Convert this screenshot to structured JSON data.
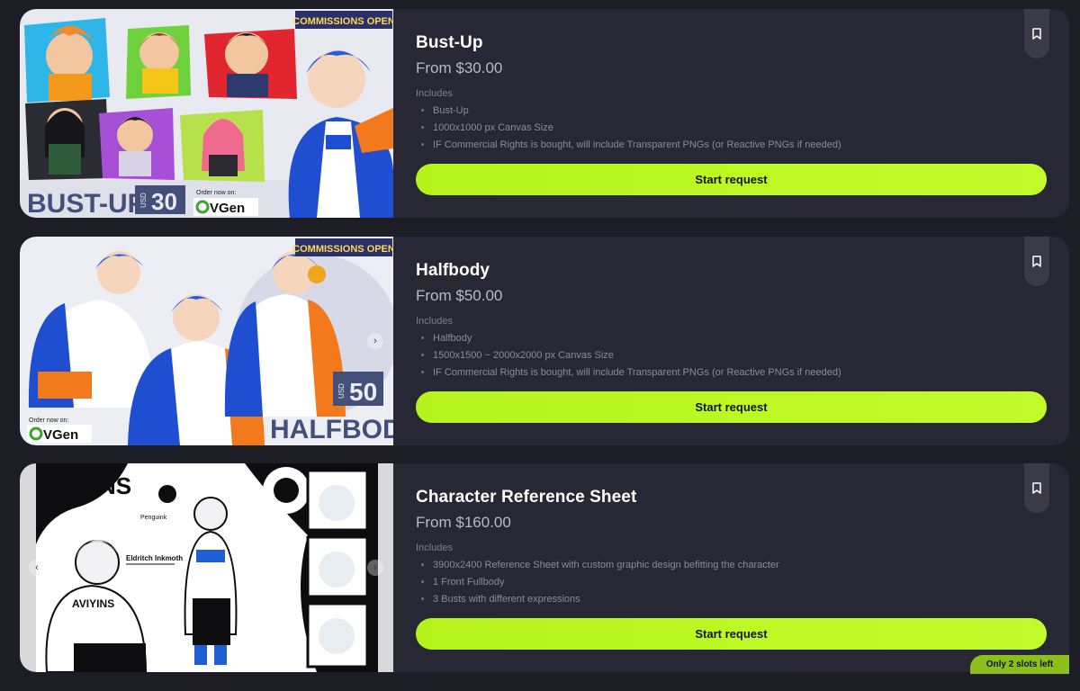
{
  "listings": [
    {
      "title": "Bust-Up",
      "price": "From $30.00",
      "includes_label": "Includes",
      "items": [
        "Bust-Up",
        "1000x1000 px Canvas Size",
        "IF Commercial Rights is bought, will include Transparent PNGs (or Reactive PNGs if needed)"
      ],
      "cta": "Start request",
      "image": {
        "banner": "COMMISSIONS OPEN",
        "headline": "BUST-UP",
        "usd_label": "USD",
        "price_tag": "30",
        "order_text": "Order now on:",
        "brand": "VGen"
      }
    },
    {
      "title": "Halfbody",
      "price": "From $50.00",
      "includes_label": "Includes",
      "items": [
        "Halfbody",
        "1500x1500 ~ 2000x2000 px Canvas Size",
        "IF Commercial Rights is bought, will include Transparent PNGs (or Reactive PNGs if needed)"
      ],
      "cta": "Start request",
      "image": {
        "banner": "COMMISSIONS OPEN",
        "headline": "HALFBODY",
        "usd_label": "USD",
        "price_tag": "50",
        "order_text": "Order now on:",
        "brand": "VGen"
      }
    },
    {
      "title": "Character Reference Sheet",
      "price": "From $160.00",
      "includes_label": "Includes",
      "items": [
        "3900x2400 Reference Sheet with custom graphic design befitting the character",
        "1 Front Fullbody",
        "3 Busts with different expressions"
      ],
      "cta": "Start request",
      "image": {
        "headline": "AVIYINS",
        "name": "Eldritch Inkmoth",
        "pet": "Penguink",
        "shirt": "AVIYINS"
      }
    }
  ],
  "slots_badge": "Only 2 slots left",
  "icons": {
    "bookmark": "bookmark-icon",
    "next": "chevron-right-icon",
    "prev": "chevron-left-icon"
  },
  "colors": {
    "accent": "#b8f71f",
    "card": "#272833",
    "page": "#1d1e25"
  }
}
